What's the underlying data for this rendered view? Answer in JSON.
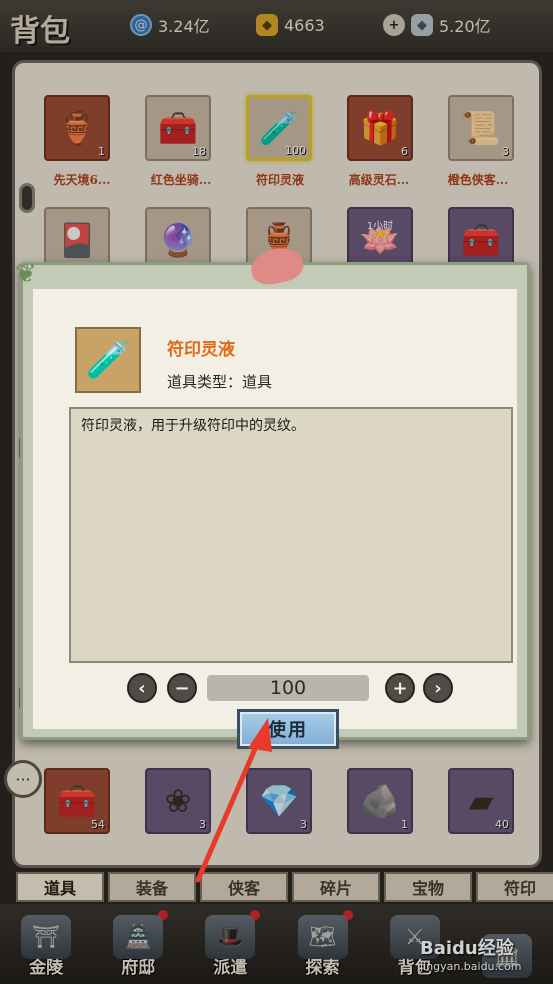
{
  "header": {
    "title": "背包",
    "currencies": [
      {
        "icon": "swirl-jade-icon",
        "value": "3.24亿"
      },
      {
        "icon": "gold-ingot-icon",
        "value": "4663"
      },
      {
        "icon": "plus-icon",
        "value": ""
      },
      {
        "icon": "silver-ingot-icon",
        "value": "5.20亿"
      }
    ]
  },
  "grid": {
    "row1": [
      {
        "name": "先天境6...",
        "count": "1",
        "icon": "cauldron-icon"
      },
      {
        "name": "红色坐骑...",
        "count": "18",
        "icon": "chest-icon"
      },
      {
        "name": "符印灵液",
        "count": "100",
        "icon": "elixir-bottle-icon"
      },
      {
        "name": "高级灵石...",
        "count": "6",
        "icon": "red-chest-icon"
      },
      {
        "name": "橙色侠客...",
        "count": "3",
        "icon": "scroll-icon"
      }
    ],
    "row2": [
      {
        "count": "",
        "icon": "talisman-icon",
        "tag": ""
      },
      {
        "count": "",
        "icon": "crystal-ball-icon",
        "tag": ""
      },
      {
        "count": "",
        "icon": "cauldron-icon",
        "tag": ""
      },
      {
        "count": "",
        "icon": "lotus-icon",
        "tag": "1小时"
      },
      {
        "count": "",
        "icon": "purple-chest-icon",
        "tag": ""
      }
    ],
    "row3": [
      {
        "count": "54",
        "icon": "treasure-chest-icon"
      },
      {
        "count": "3",
        "icon": "cotton-icon"
      },
      {
        "count": "3",
        "icon": "jade-gem-icon"
      },
      {
        "count": "1",
        "icon": "green-ore-icon"
      },
      {
        "count": "40",
        "icon": "iron-ingot-icon"
      }
    ]
  },
  "tabs": [
    "道具",
    "装备",
    "侠客",
    "碎片",
    "宝物",
    "符印"
  ],
  "active_tab": "道具",
  "nav": [
    {
      "label": "金陵",
      "icon": "city-gate-icon",
      "dot": false
    },
    {
      "label": "府邸",
      "icon": "mansion-icon",
      "dot": true
    },
    {
      "label": "派遣",
      "icon": "bamboo-hat-icon",
      "dot": true
    },
    {
      "label": "探索",
      "icon": "map-scroll-icon",
      "dot": true
    },
    {
      "label": "背包",
      "icon": "crossed-swords-icon",
      "dot": false
    },
    {
      "label": "",
      "icon": "pavilion-icon",
      "dot": false
    }
  ],
  "watermark": {
    "brand": "Baidu经验",
    "url": "jingyan.baidu.com"
  },
  "dialog": {
    "item_name": "符印灵液",
    "item_type_label": "道具类型：道具",
    "description": "符印灵液，用于升级符印中的灵纹。",
    "quantity": "100",
    "use_label": "使用",
    "icon": "elixir-bottle-icon"
  },
  "colors": {
    "item_name": "#e06a16",
    "item_label": "#b0421c",
    "use_button": "#a9cce7",
    "annotation_arrow": "#e83a2a"
  }
}
